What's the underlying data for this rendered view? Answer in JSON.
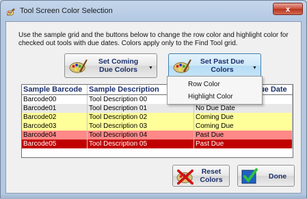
{
  "window": {
    "title": "Tool Screen Color Selection",
    "close_label": "x"
  },
  "instructions": "Use the sample grid and the buttons below to change the row color and highlight color for checked out tools with due dates. Colors apply only to the Find Tool grid.",
  "buttons": {
    "coming_due": "Set Coming Due Colors",
    "past_due": "Set Past Due Colors",
    "reset": "Reset Colors",
    "done": "Done"
  },
  "popup_menu": {
    "items": [
      "Row Color",
      "Highlight Color"
    ]
  },
  "grid": {
    "columns": [
      "Sample Barcode",
      "Sample Description",
      "Due Date"
    ],
    "rows": [
      {
        "barcode": "Barcode00",
        "description": "Tool Description 00",
        "status": "",
        "bg": "#ffffff",
        "fg": "#000000"
      },
      {
        "barcode": "Barcode01",
        "description": "Tool Description 01",
        "status": "No Due Date",
        "bg": "#e8e8e8",
        "fg": "#000000"
      },
      {
        "barcode": "Barcode02",
        "description": "Tool Description 02",
        "status": "Coming Due",
        "bg": "#ffff99",
        "fg": "#000000"
      },
      {
        "barcode": "Barcode03",
        "description": "Tool Description 03",
        "status": "Coming Due",
        "bg": "#ffff99",
        "fg": "#000000"
      },
      {
        "barcode": "Barcode04",
        "description": "Tool Description 04",
        "status": "Past Due",
        "bg": "#ff8888",
        "fg": "#000000"
      },
      {
        "barcode": "Barcode05",
        "description": "Tool Description 05",
        "status": "Past Due",
        "bg": "#c00000",
        "fg": "#ffffff"
      }
    ]
  }
}
